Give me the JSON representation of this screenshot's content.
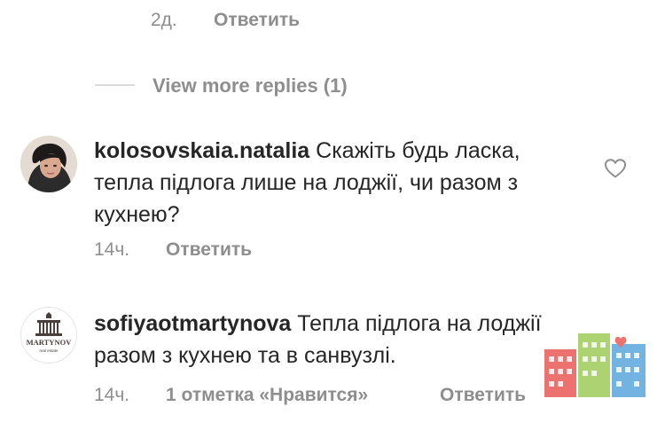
{
  "top_meta": {
    "time": "2д.",
    "reply": "Ответить"
  },
  "view_more": {
    "label": "View more replies (1)"
  },
  "comments": [
    {
      "username": "kolosovskaia.natalia",
      "text": "Скажіть будь ласка, тепла підлога лише на лоджії, чи разом з кухнею?",
      "time": "14ч.",
      "reply": "Ответить",
      "avatar_icon": "user-photo"
    },
    {
      "username": "sofiyaotmartynova",
      "text": "Тепла підлога на лоджії разом з кухнею та в санвузлі.",
      "time": "14ч.",
      "likes": "1 отметка «Нравится»",
      "reply": "Ответить",
      "avatar_icon": "martynov-logo"
    }
  ],
  "avatar_logo": {
    "brand": "MARTYNOV",
    "sub": "real estate"
  },
  "icons": {
    "like": "heart-outline-icon"
  },
  "colors": {
    "text": "#262626",
    "meta": "#8e8e8e",
    "divider": "#dbdbdb"
  }
}
